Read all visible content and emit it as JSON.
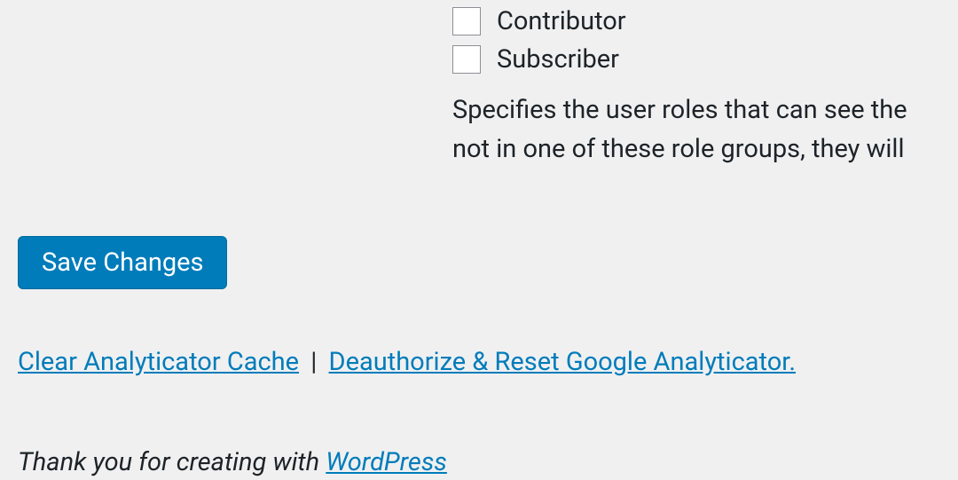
{
  "roles": {
    "contributor": {
      "label": "Contributor",
      "checked": false
    },
    "subscriber": {
      "label": "Subscriber",
      "checked": false
    }
  },
  "description": {
    "line1": "Specifies the user roles that can see the",
    "line2": "not in one of these role groups, they will"
  },
  "buttons": {
    "save_label": "Save Changes"
  },
  "links": {
    "clear_cache": "Clear Analyticator Cache",
    "separator": "|",
    "deauthorize": "Deauthorize & Reset Google Analyticator."
  },
  "footer": {
    "prefix": "Thank you for creating with ",
    "link": "WordPress"
  }
}
